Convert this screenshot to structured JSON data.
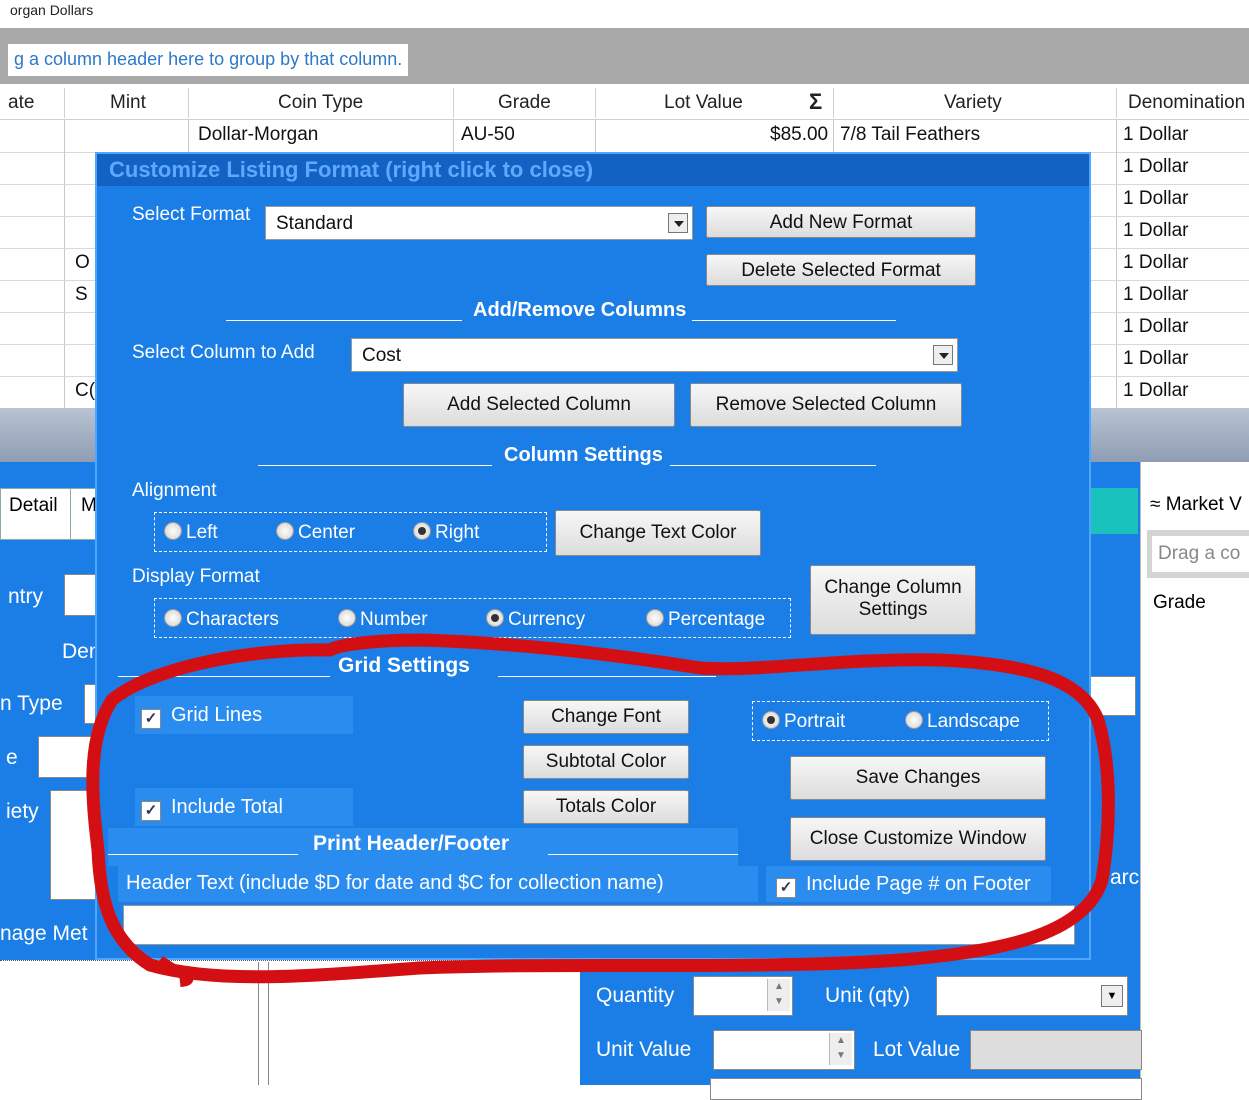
{
  "window": {
    "title_fragment": "organ Dollars"
  },
  "grid": {
    "group_hint": "g a column header here to group by that column.",
    "headers": {
      "date": "ate",
      "mint": "Mint",
      "coin_type": "Coin Type",
      "grade": "Grade",
      "lot_value": "Lot Value",
      "sigma": "Σ",
      "variety": "Variety",
      "denomination": "Denomination"
    },
    "row1": {
      "coin_type": "Dollar-Morgan",
      "grade": "AU-50",
      "lot_value": "$85.00",
      "variety": "7/8 Tail Feathers",
      "denomination": "1 Dollar"
    },
    "rows": [
      {
        "mint": "",
        "denomination": "1 Dollar"
      },
      {
        "mint": "",
        "denomination": "1 Dollar"
      },
      {
        "mint": "",
        "denomination": "1 Dollar"
      },
      {
        "mint": "O",
        "denomination": "1 Dollar"
      },
      {
        "mint": "S",
        "denomination": "1 Dollar"
      },
      {
        "mint": "",
        "denomination": "1 Dollar"
      },
      {
        "mint": "",
        "denomination": "1 Dollar"
      },
      {
        "mint": "C(",
        "denomination": "1 Dollar"
      }
    ]
  },
  "background": {
    "tab_detail": "Detail",
    "tab_m": "M",
    "market_label": "Market V",
    "drag_hint": "Drag a co",
    "grade_label": "Grade",
    "country": "ntry",
    "den": "Den",
    "type": "n Type",
    "e": "e",
    "variety": "iety",
    "image": "nage Met",
    "arc": "arc",
    "quantity": "Quantity",
    "unit_qty": "Unit (qty)",
    "unit_value": "Unit Value",
    "lot_value": "Lot Value"
  },
  "dialog": {
    "title": "Customize Listing Format (right click to close)",
    "select_format_label": "Select Format",
    "format_value": "Standard",
    "add_new_format": "Add New Format",
    "delete_selected_format": "Delete Selected Format",
    "add_remove_columns": "Add/Remove Columns",
    "select_column_label": "Select Column to Add",
    "column_value": "Cost",
    "add_selected_column": "Add Selected Column",
    "remove_selected_column": "Remove Selected Column",
    "column_settings": "Column Settings",
    "alignment": "Alignment",
    "align_left": "Left",
    "align_center": "Center",
    "align_right": "Right",
    "change_text_color": "Change Text Color",
    "display_format": "Display Format",
    "fmt_characters": "Characters",
    "fmt_number": "Number",
    "fmt_currency": "Currency",
    "fmt_percentage": "Percentage",
    "change_column_settings_1": "Change Column",
    "change_column_settings_2": "Settings",
    "grid_settings": "Grid Settings",
    "grid_lines": "Grid Lines",
    "include_total": "Include Total",
    "change_font": "Change Font",
    "subtotal_color": "Subtotal Color",
    "totals_color": "Totals Color",
    "portrait": "Portrait",
    "landscape": "Landscape",
    "save_changes": "Save Changes",
    "close_customize": "Close Customize Window",
    "print_header_footer": "Print Header/Footer",
    "header_text_label": "Header Text (include $D for date and $C for collection name)",
    "include_page_footer": "Include Page # on Footer",
    "check_mark": "✓"
  },
  "colors": {
    "dialog_bg": "#1a7ee6",
    "title_bar": "#1262c3",
    "annotation_ring": "#d40f14",
    "teal_bar": "#19c2bd"
  }
}
